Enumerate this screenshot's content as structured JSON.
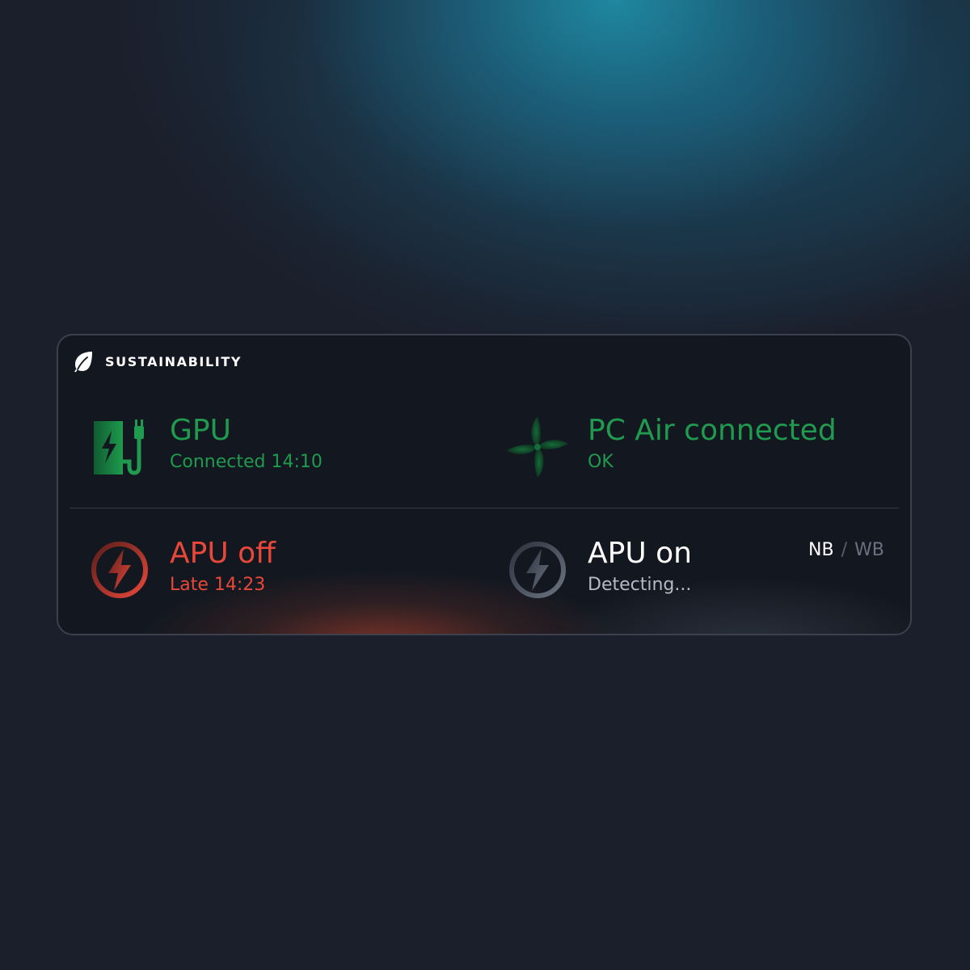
{
  "widget": {
    "title": "SUSTAINABILITY",
    "icon": "leaf-icon"
  },
  "tiles": [
    {
      "title": "GPU",
      "status": "Connected 14:10",
      "icon": "ev-charger-icon",
      "color": "#1f9a4e"
    },
    {
      "title": "PC Air connected",
      "status": "OK",
      "icon": "fan-icon",
      "color": "#1f9a4e"
    },
    {
      "title": "APU off",
      "status": "Late 14:23",
      "icon": "power-bolt-icon",
      "color": "#e8483a"
    },
    {
      "title": "APU on",
      "status": "Detecting...",
      "icon": "power-bolt-icon",
      "color": "#ffffff"
    }
  ],
  "toggle": {
    "active": "NB",
    "separator": "/",
    "inactive": "WB"
  }
}
